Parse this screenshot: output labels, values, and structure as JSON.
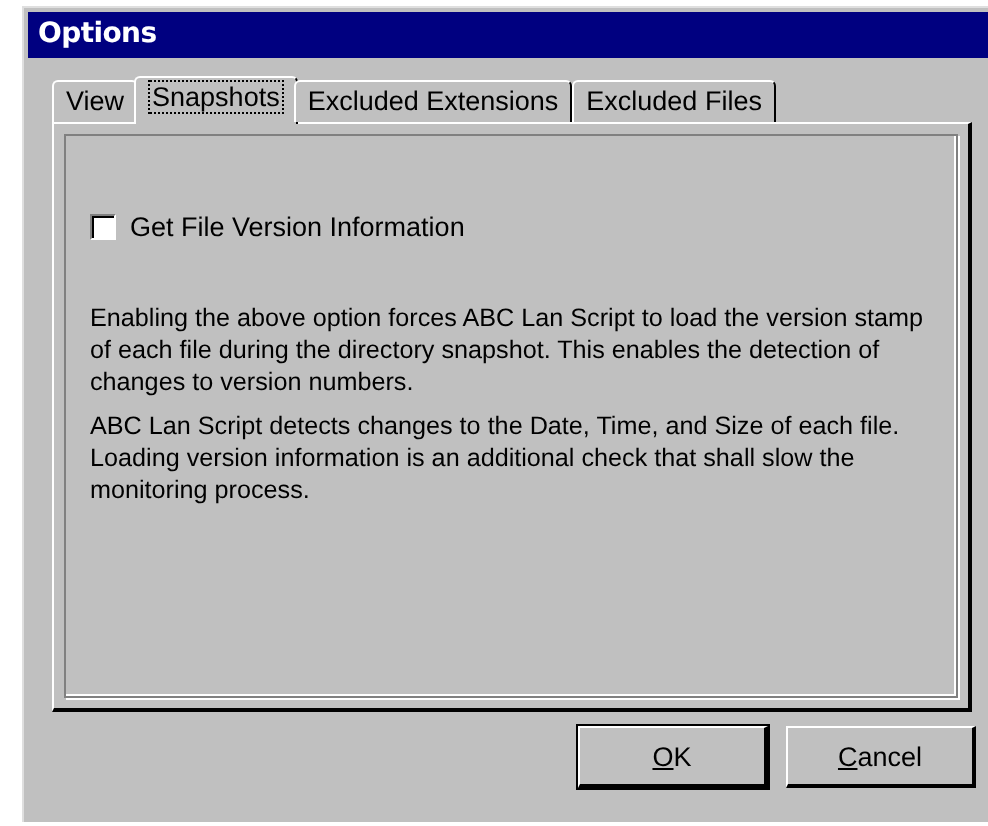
{
  "window": {
    "title": "Options"
  },
  "tabs": [
    {
      "label": "View",
      "selected": false
    },
    {
      "label": "Snapshots",
      "selected": true
    },
    {
      "label": "Excluded Extensions",
      "selected": false
    },
    {
      "label": "Excluded Files",
      "selected": false
    }
  ],
  "option": {
    "label": "Get File Version Information",
    "checked": false
  },
  "paragraphs": [
    "Enabling the above option forces ABC Lan Script to load the version stamp of each file during the directory snapshot.  This enables the detection of changes to version numbers.",
    "ABC Lan Script detects changes to the Date, Time, and Size of each file.  Loading version information is an additional check that shall slow the monitoring process."
  ],
  "buttons": [
    {
      "mnemonic": "O",
      "label_rest": "K",
      "default": true
    },
    {
      "mnemonic": "C",
      "label_rest": "ancel",
      "default": false
    }
  ]
}
